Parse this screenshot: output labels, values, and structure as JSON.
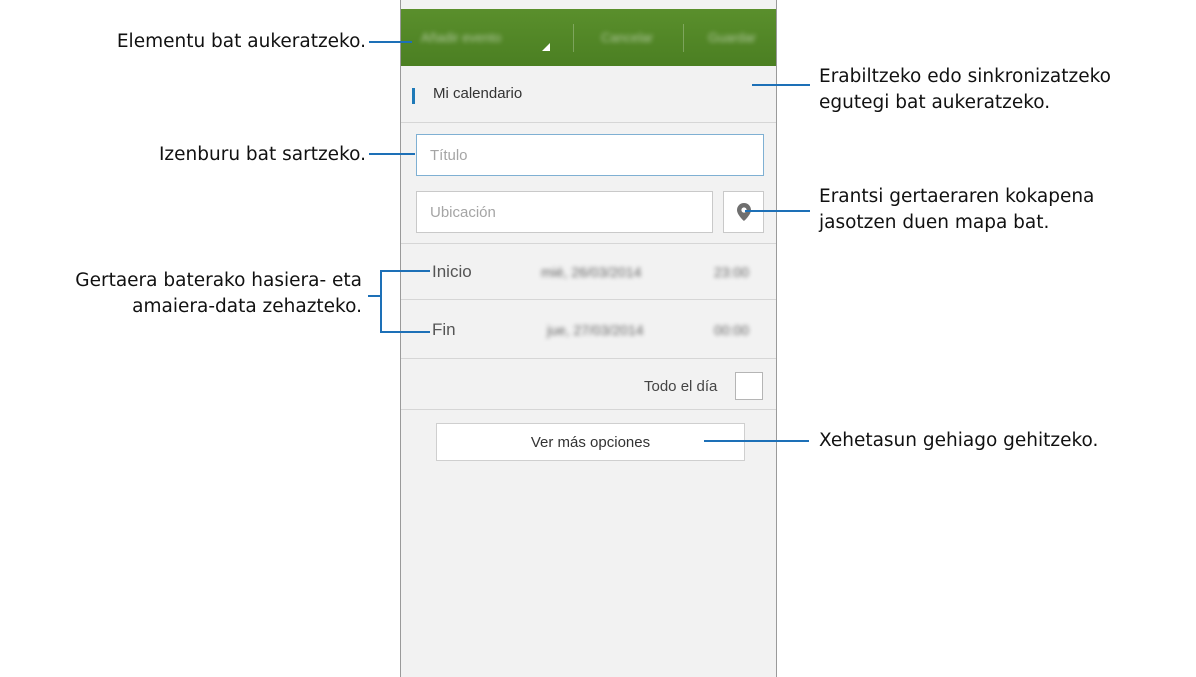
{
  "annotations": {
    "select_item": "Elementu bat aukeratzeko.",
    "calendar_line1": "Erabiltzeko edo sinkronizatzeko",
    "calendar_line2": "egutegi bat aukeratzeko.",
    "title_input": "Izenburu bat sartzeko.",
    "map_line1": "Erantsi gertaeraren kokapena",
    "map_line2": "jasotzen duen mapa bat.",
    "dates_line1": "Gertaera baterako hasiera- eta",
    "dates_line2": "amaiera-data zehazteko.",
    "more_details": "Xehetasun gehiago gehitzeko."
  },
  "screen": {
    "action_bar": {
      "spinner_label": "Añadir evento",
      "cancel_label": "Cancelar",
      "save_label": "Guardar",
      "color": "#4f8426"
    },
    "calendar": {
      "name": "Mi calendario",
      "accent": "#1f7ab8"
    },
    "title_field": {
      "placeholder": "Título"
    },
    "location_field": {
      "placeholder": "Ubicación",
      "icon": "map-pin-icon"
    },
    "start": {
      "label": "Inicio",
      "date": "mié, 26/03/2014",
      "time": "23:00"
    },
    "end": {
      "label": "Fin",
      "date": "jue, 27/03/2014",
      "time": "00:00"
    },
    "all_day": {
      "label": "Todo el día",
      "checked": false
    },
    "more_options": {
      "label": "Ver más opciones"
    }
  }
}
